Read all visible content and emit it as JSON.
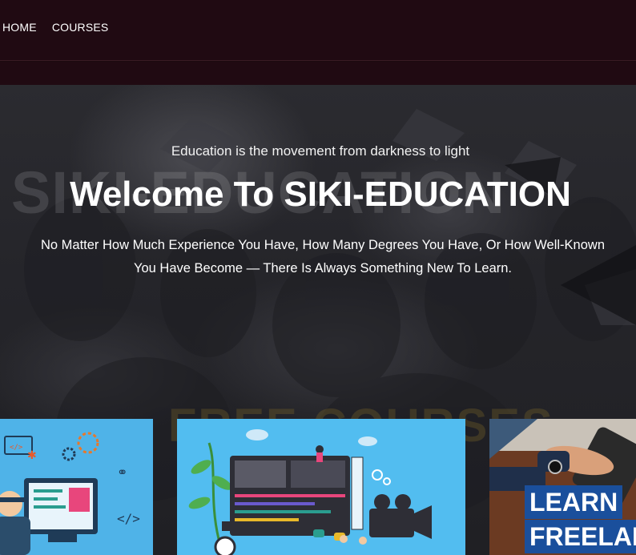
{
  "nav": {
    "items": [
      {
        "label": "HOME"
      },
      {
        "label": "COURSES"
      }
    ]
  },
  "hero": {
    "tagline": "Education is the movement from darkness to light",
    "ghost_title": "SIKI-EDUCATION",
    "title": "Welcome To SIKI-EDUCATION",
    "subtitle_line1": "No Matter How Much Experience You Have, How Many Degrees You Have, Or How Well-Known",
    "subtitle_line2": "You Have Become — There Is Always Something New To Learn.",
    "ghost_section": "FREE COURSES"
  },
  "cards": [
    {
      "label": ""
    },
    {
      "label": ""
    },
    {
      "line1": "LEARN",
      "line2": "FREELAN"
    }
  ],
  "colors": {
    "nav_bg": "#200a12",
    "hero_overlay": "#25252a",
    "card1_bg": "#4fb3e8",
    "card2_bg": "#52bdf0",
    "learn_box": "#1a4f9c"
  }
}
